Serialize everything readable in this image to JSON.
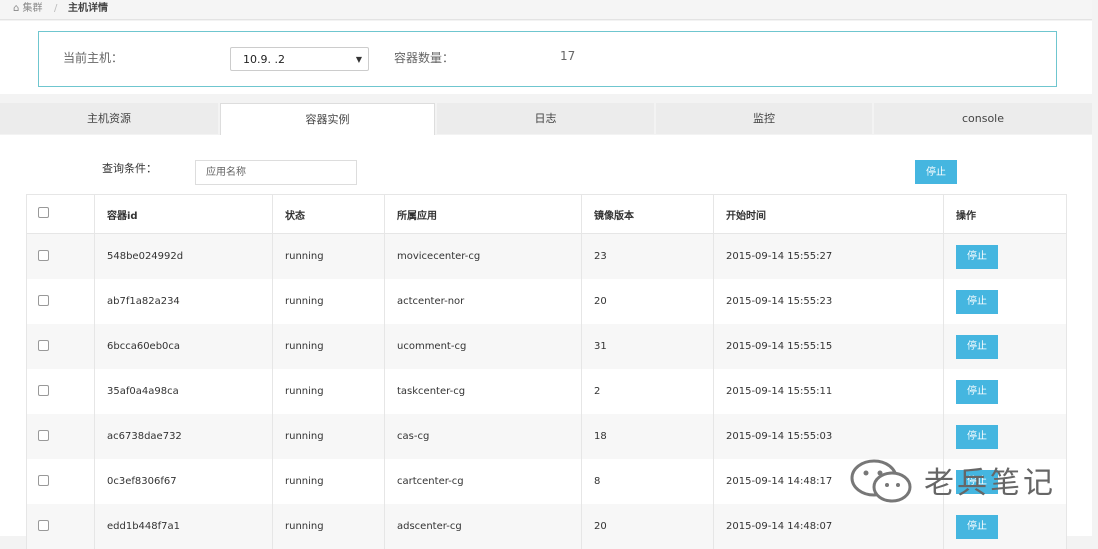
{
  "breadcrumb": {
    "parent": "集群",
    "separator": "/",
    "current": "主机详情"
  },
  "host": {
    "label": "当前主机：",
    "selected": "10.9.    .2",
    "count_label": "容器数量：",
    "count_value": "17"
  },
  "tabs": [
    {
      "label": "主机资源"
    },
    {
      "label": "容器实例"
    },
    {
      "label": "日志"
    },
    {
      "label": "监控"
    },
    {
      "label": "console"
    }
  ],
  "query": {
    "label": "查询条件：",
    "placeholder": "应用名称",
    "stop_label": "停止"
  },
  "table": {
    "headers": [
      "容器id",
      "状态",
      "所属应用",
      "镜像版本",
      "开始时间",
      "操作"
    ],
    "rows": [
      {
        "id": "548be024992d",
        "status": "running",
        "app": "movicecenter-cg",
        "version": "23",
        "start": "2015-09-14 15:55:27",
        "action": "停止"
      },
      {
        "id": "ab7f1a82a234",
        "status": "running",
        "app": "actcenter-nor",
        "version": "20",
        "start": "2015-09-14 15:55:23",
        "action": "停止"
      },
      {
        "id": "6bcca60eb0ca",
        "status": "running",
        "app": "ucomment-cg",
        "version": "31",
        "start": "2015-09-14 15:55:15",
        "action": "停止"
      },
      {
        "id": "35af0a4a98ca",
        "status": "running",
        "app": "taskcenter-cg",
        "version": "2",
        "start": "2015-09-14 15:55:11",
        "action": "停止"
      },
      {
        "id": "ac6738dae732",
        "status": "running",
        "app": "cas-cg",
        "version": "18",
        "start": "2015-09-14 15:55:03",
        "action": "停止"
      },
      {
        "id": "0c3ef8306f67",
        "status": "running",
        "app": "cartcenter-cg",
        "version": "8",
        "start": "2015-09-14 14:48:17",
        "action": "停止"
      },
      {
        "id": "edd1b448f7a1",
        "status": "running",
        "app": "adscenter-cg",
        "version": "20",
        "start": "2015-09-14 14:48:07",
        "action": "停止"
      }
    ]
  },
  "watermark": {
    "text": "老兵笔记"
  },
  "colors": {
    "accent": "#45b6e0",
    "border": "#6fc6cf"
  }
}
